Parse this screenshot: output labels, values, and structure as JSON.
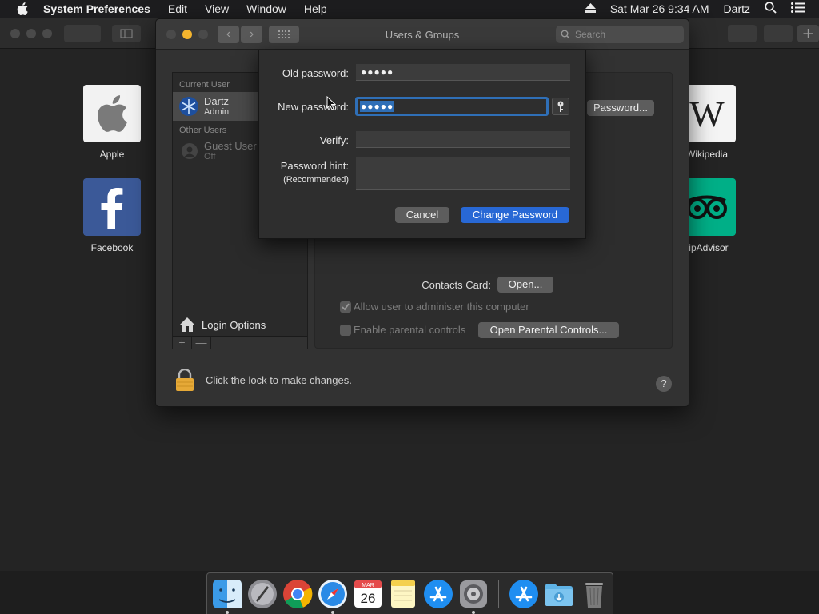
{
  "menubar": {
    "app_name": "System Preferences",
    "menus": [
      "Edit",
      "View",
      "Window",
      "Help"
    ],
    "datetime": "Sat Mar 26  9:34 AM",
    "user": "Dartz"
  },
  "browser": {
    "favorites": [
      {
        "label": "Apple"
      },
      {
        "label": "Facebook"
      },
      {
        "label": "Wikipedia"
      },
      {
        "label": "ripAdvisor"
      }
    ]
  },
  "prefs": {
    "title": "Users & Groups",
    "search_placeholder": "Search",
    "current_user_header": "Current User",
    "current_user": {
      "name": "Dartz",
      "role": "Admin"
    },
    "other_users_header": "Other Users",
    "guest_user": {
      "name": "Guest User",
      "status": "Off"
    },
    "login_options": "Login Options",
    "add_label": "+",
    "remove_label": "—",
    "change_password_button": "Password...",
    "contacts_card_label": "Contacts Card:",
    "open_button": "Open...",
    "allow_admin_label": "Allow user to administer this computer",
    "parental_label": "Enable parental controls",
    "open_parental_button": "Open Parental Controls...",
    "lock_text": "Click the lock to make changes.",
    "help": "?"
  },
  "sheet": {
    "old_password_label": "Old password:",
    "old_password_value": "●●●●●",
    "new_password_label": "New password:",
    "new_password_value": "●●●●●",
    "verify_label": "Verify:",
    "verify_value": "",
    "hint_label": "Password hint:",
    "hint_sub_label": "(Recommended)",
    "hint_value": "",
    "cancel": "Cancel",
    "change": "Change Password"
  },
  "dock": {
    "calendar_month": "MAR",
    "calendar_day": "26"
  },
  "colors": {
    "accent": "#2868d5",
    "focus_ring": "#2f6fb7",
    "close": "#4a4a4a",
    "minimize": "#f5b52e",
    "lock": "#e6a937",
    "facebook": "#3b5998",
    "tripadvisor": "#00af87"
  }
}
